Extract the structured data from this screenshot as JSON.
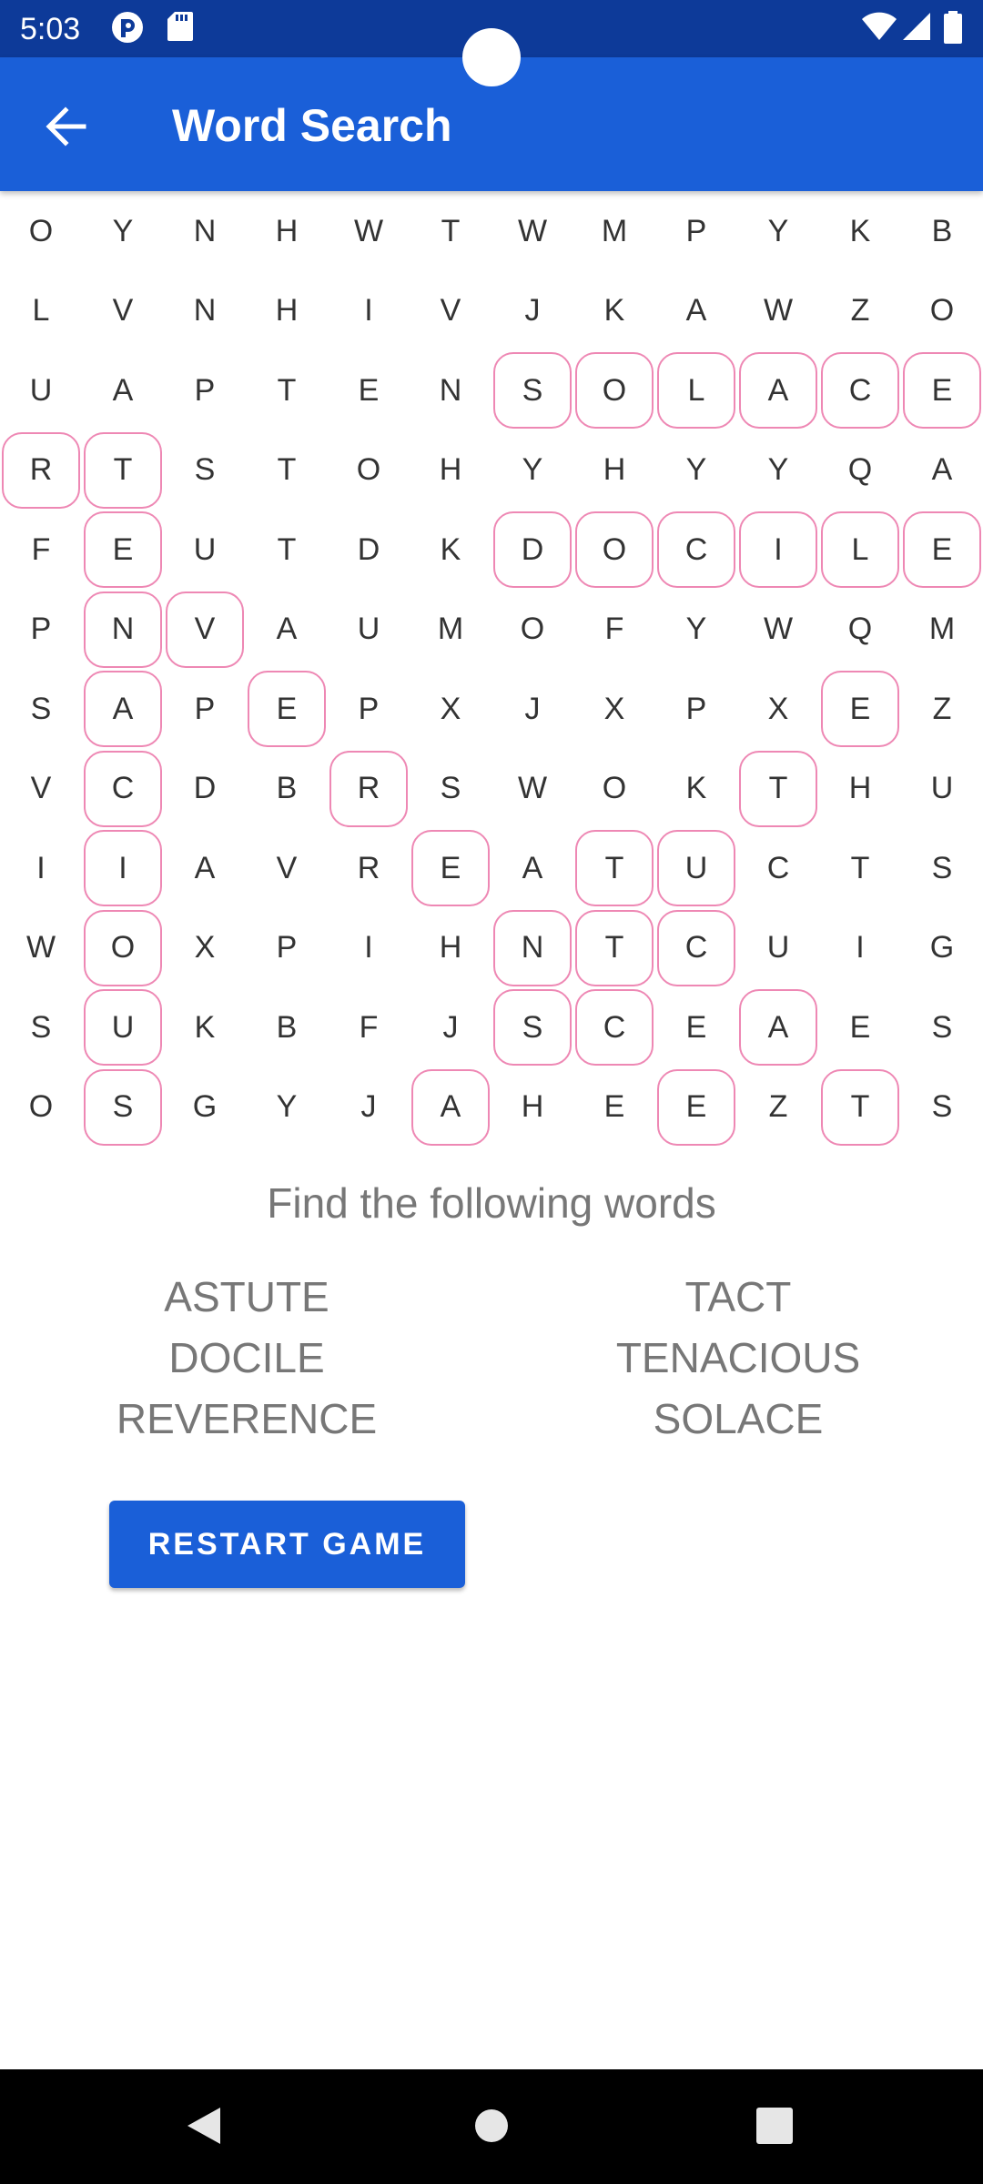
{
  "status_bar": {
    "time": "5:03",
    "left_icons": [
      "pocket-icon",
      "sd-card-icon"
    ],
    "right_icons": [
      "wifi-icon",
      "signal-icon",
      "battery-icon"
    ]
  },
  "app_bar": {
    "title": "Word Search",
    "back_icon": "arrow-back-icon"
  },
  "grid": {
    "rows": [
      [
        "O",
        "Y",
        "N",
        "H",
        "W",
        "T",
        "W",
        "M",
        "P",
        "Y",
        "K",
        "B"
      ],
      [
        "L",
        "V",
        "N",
        "H",
        "I",
        "V",
        "J",
        "K",
        "A",
        "W",
        "Z",
        "O"
      ],
      [
        "U",
        "A",
        "P",
        "T",
        "E",
        "N",
        "S",
        "O",
        "L",
        "A",
        "C",
        "E"
      ],
      [
        "R",
        "T",
        "S",
        "T",
        "O",
        "H",
        "Y",
        "H",
        "Y",
        "Y",
        "Q",
        "A"
      ],
      [
        "F",
        "E",
        "U",
        "T",
        "D",
        "K",
        "D",
        "O",
        "C",
        "I",
        "L",
        "E"
      ],
      [
        "P",
        "N",
        "V",
        "A",
        "U",
        "M",
        "O",
        "F",
        "Y",
        "W",
        "Q",
        "M"
      ],
      [
        "S",
        "A",
        "P",
        "E",
        "P",
        "X",
        "J",
        "X",
        "P",
        "X",
        "E",
        "Z"
      ],
      [
        "V",
        "C",
        "D",
        "B",
        "R",
        "S",
        "W",
        "O",
        "K",
        "T",
        "H",
        "U"
      ],
      [
        "I",
        "I",
        "A",
        "V",
        "R",
        "E",
        "A",
        "T",
        "U",
        "C",
        "T",
        "S"
      ],
      [
        "W",
        "O",
        "X",
        "P",
        "I",
        "H",
        "N",
        "T",
        "C",
        "U",
        "I",
        "G"
      ],
      [
        "S",
        "U",
        "K",
        "B",
        "F",
        "J",
        "S",
        "C",
        "E",
        "A",
        "E",
        "S"
      ],
      [
        "O",
        "S",
        "G",
        "Y",
        "J",
        "A",
        "H",
        "E",
        "E",
        "Z",
        "T",
        "S"
      ]
    ],
    "highlighted": [
      [
        2,
        6
      ],
      [
        2,
        7
      ],
      [
        2,
        8
      ],
      [
        2,
        9
      ],
      [
        2,
        10
      ],
      [
        2,
        11
      ],
      [
        3,
        0
      ],
      [
        3,
        1
      ],
      [
        4,
        1
      ],
      [
        4,
        6
      ],
      [
        4,
        7
      ],
      [
        4,
        8
      ],
      [
        4,
        9
      ],
      [
        4,
        10
      ],
      [
        4,
        11
      ],
      [
        5,
        1
      ],
      [
        5,
        2
      ],
      [
        6,
        1
      ],
      [
        6,
        3
      ],
      [
        6,
        10
      ],
      [
        7,
        1
      ],
      [
        7,
        4
      ],
      [
        7,
        9
      ],
      [
        8,
        1
      ],
      [
        8,
        5
      ],
      [
        8,
        7
      ],
      [
        8,
        8
      ],
      [
        9,
        1
      ],
      [
        9,
        6
      ],
      [
        9,
        7
      ],
      [
        9,
        8
      ],
      [
        10,
        1
      ],
      [
        10,
        6
      ],
      [
        10,
        7
      ],
      [
        10,
        9
      ],
      [
        11,
        1
      ],
      [
        11,
        5
      ],
      [
        11,
        8
      ],
      [
        11,
        10
      ]
    ],
    "highlight_color": "#ee88b4"
  },
  "find_title": "Find the following words",
  "words_left": [
    "ASTUTE",
    "DOCILE",
    "REVERENCE"
  ],
  "words_right": [
    "TACT",
    "TENACIOUS",
    "SOLACE"
  ],
  "restart_label": "RESTART GAME",
  "colors": {
    "status_bar": "#0d3a99",
    "app_bar": "#1a5fd8",
    "button": "#1a5fd8"
  },
  "nav_bar": {
    "icons": [
      "back-triangle-icon",
      "home-circle-icon",
      "recents-square-icon"
    ]
  }
}
